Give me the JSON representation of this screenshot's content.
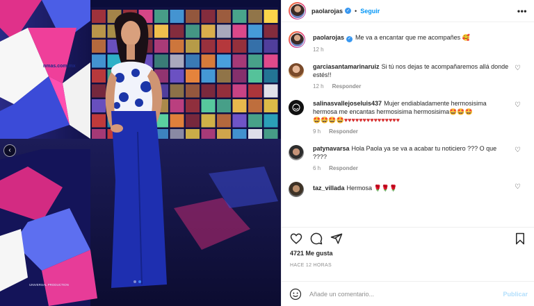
{
  "post": {
    "author": "paolarojas",
    "follow_label": "Seguir",
    "separator": "•",
    "more_label": "•••"
  },
  "caption": {
    "author": "paolarojas",
    "text": "Me va a encantar que me acompañes 🥰",
    "time": "12 h"
  },
  "comments": [
    {
      "user": "garciasantamarinaruiz",
      "text": "Si tú nos dejas te acompañaremos allá donde estés!!",
      "time": "12 h",
      "reply": "Responder"
    },
    {
      "user": "salinasvallejoseluis437",
      "text": "Mujer endiabladamente hermosisima hermosa me encantas hermosisima hermosisima",
      "emojis1": "🤩🤩🤩",
      "emojis2": "🤩🤩🤩🤩",
      "hearts": "♥♥♥♥♥♥♥♥♥♥♥♥♥♥♥",
      "time": "9 h",
      "reply": "Responder"
    },
    {
      "user": "patynavarsa",
      "text": "Hola Paola ya se va a acabar tu noticiero ??? O que ????",
      "time": "6 h",
      "reply": "Responder"
    },
    {
      "user": "taz_villada",
      "text": "Hermosa 🌹🌹🌹",
      "time": "",
      "reply": ""
    }
  ],
  "likes": "4721 Me gusta",
  "posted": "HACE 12 HORAS",
  "composer": {
    "placeholder": "Añade un comentario...",
    "publish_label": "Publicar"
  },
  "media": {
    "backdrop_text": "nmas.com.mx",
    "floor_text": "UNIVERSAL PRODUCTION",
    "carousel_prev": "‹",
    "slide_count": 2,
    "active_slide": 2
  },
  "colors": {
    "accent": "#0095f6",
    "publish_disabled": "#b2dffc",
    "verified": "#3897f0",
    "muted": "#8e8e8e"
  }
}
